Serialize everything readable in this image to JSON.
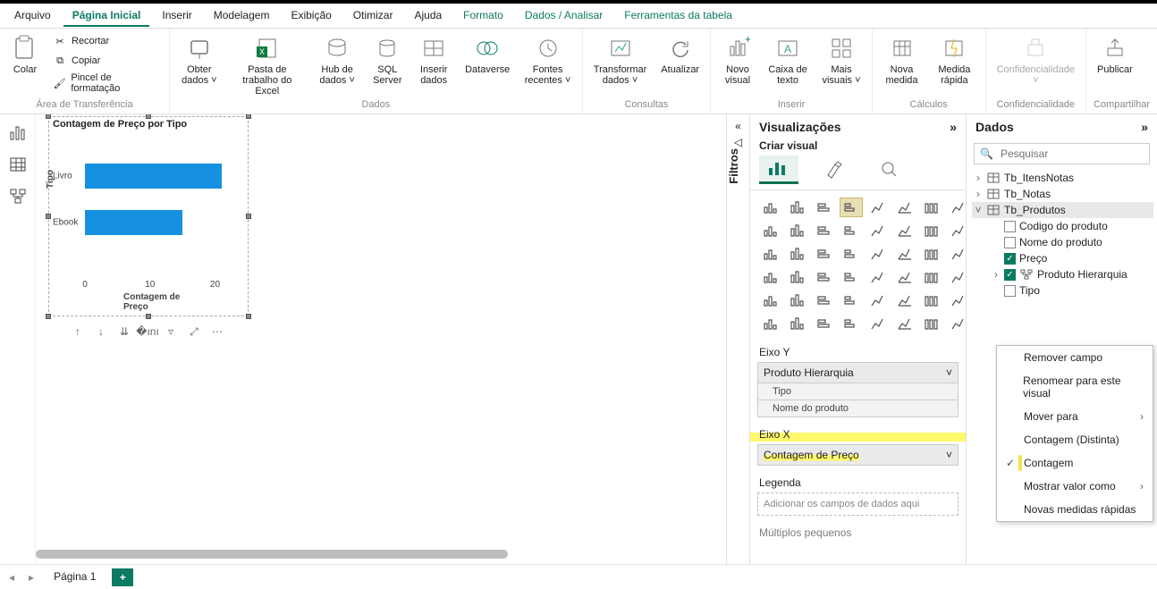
{
  "menu": {
    "items": [
      "Arquivo",
      "Página Inicial",
      "Inserir",
      "Modelagem",
      "Exibição",
      "Otimizar",
      "Ajuda",
      "Formato",
      "Dados / Analisar",
      "Ferramentas da tabela"
    ],
    "active_index": 1,
    "context_indices": [
      7,
      8,
      9
    ]
  },
  "ribbon": {
    "clipboard": {
      "label": "Área de Transferência",
      "paste": {
        "label": "Colar"
      },
      "cut": {
        "label": "Recortar"
      },
      "copy": {
        "label": "Copiar"
      },
      "format_painter": {
        "label": "Pincel de formatação"
      }
    },
    "data": {
      "label": "Dados",
      "get_data": {
        "label": "Obter dados ˅"
      },
      "excel": {
        "label": "Pasta de trabalho do Excel"
      },
      "hub": {
        "label": "Hub de dados ˅"
      },
      "sql": {
        "label": "SQL Server"
      },
      "enter": {
        "label": "Inserir dados"
      },
      "dataverse": {
        "label": "Dataverse"
      },
      "recent": {
        "label": "Fontes recentes ˅"
      }
    },
    "queries": {
      "label": "Consultas",
      "transform": {
        "label": "Transformar dados ˅"
      },
      "refresh": {
        "label": "Atualizar"
      }
    },
    "insert": {
      "label": "Inserir",
      "newvis": {
        "label": "Novo visual"
      },
      "textbox": {
        "label": "Caixa de texto"
      },
      "morevis": {
        "label": "Mais visuais ˅"
      }
    },
    "calc": {
      "label": "Cálculos",
      "measure": {
        "label": "Nova medida"
      },
      "quick": {
        "label": "Medida rápida"
      }
    },
    "sens": {
      "label": "Confidencialidade",
      "btn": {
        "label": "Confidencialidade ˅"
      }
    },
    "share": {
      "label": "Compartilhar",
      "publish": {
        "label": "Publicar"
      }
    }
  },
  "pane_headers": {
    "visualizations": "Visualizações",
    "build": "Criar visual",
    "data": "Dados",
    "filters": "Filtros"
  },
  "fields": {
    "axis_y_label": "Eixo Y",
    "axis_y_field": "Produto Hierarquia",
    "axis_y_sub1": "Tipo",
    "axis_y_sub2": "Nome do produto",
    "axis_x_label": "Eixo X",
    "axis_x_field": "Contagem de Preço",
    "legend_label": "Legenda",
    "legend_placeholder": "Adicionar os campos de dados aqui",
    "small_mult_label": "Múltiplos pequenos"
  },
  "search": {
    "placeholder": "Pesquisar"
  },
  "tree": {
    "tables": [
      {
        "name": "Tb_ItensNotas",
        "expanded": false
      },
      {
        "name": "Tb_Notas",
        "expanded": false
      },
      {
        "name": "Tb_Produtos",
        "expanded": true,
        "selected": true,
        "fields": [
          {
            "name": "Codigo do produto",
            "checked": false
          },
          {
            "name": "Nome do produto",
            "checked": false
          },
          {
            "name": "Preço",
            "checked": true
          },
          {
            "name": "Produto Hierarquia",
            "checked": true,
            "hier": true
          },
          {
            "name": "Tipo",
            "checked": false
          }
        ]
      }
    ]
  },
  "context_menu": {
    "items": [
      {
        "label": "Remover campo"
      },
      {
        "label": "Renomear para este visual"
      },
      {
        "label": "Mover para",
        "submenu": true
      },
      {
        "label": "Contagem (Distinta)"
      },
      {
        "label": "Contagem",
        "checked": true,
        "highlight": true
      },
      {
        "label": "Mostrar valor como",
        "submenu": true
      },
      {
        "label": "Novas medidas rápidas"
      }
    ]
  },
  "page_tabs": {
    "page1": "Página 1"
  },
  "chart_data": {
    "type": "bar",
    "orientation": "horizontal",
    "title": "Contagem de Preço por Tipo",
    "categories": [
      "Livro",
      "Ebook"
    ],
    "values": [
      21,
      15
    ],
    "xlabel": "Contagem de Preço",
    "ylabel": "Tipo",
    "xticks": [
      0,
      10,
      20
    ],
    "xlim": [
      0,
      22
    ]
  }
}
